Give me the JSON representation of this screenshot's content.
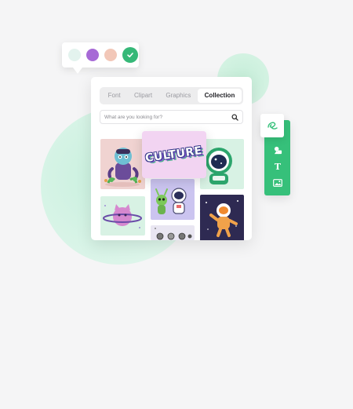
{
  "palette": {
    "swatches": [
      {
        "name": "mint",
        "color": "#e3f3ee"
      },
      {
        "name": "purple",
        "color": "#a76ad6"
      },
      {
        "name": "peach",
        "color": "#f2c7b8"
      },
      {
        "name": "green",
        "color": "#36b878",
        "selected": true
      }
    ]
  },
  "tabs": [
    {
      "label": "Font"
    },
    {
      "label": "Clipart"
    },
    {
      "label": "Graphics"
    },
    {
      "label": "Collection",
      "active": true
    }
  ],
  "search": {
    "placeholder": "What are you looking for?",
    "icon": "search-icon"
  },
  "overlay": {
    "text": "CULTURE"
  },
  "toolbar": {
    "items": [
      "brush-icon",
      "shapes-icon",
      "text-icon",
      "image-icon"
    ],
    "text_glyph": "T"
  },
  "colors": {
    "accent": "#36c07a",
    "card_bg": "#ffffff",
    "page_bg": "#f5f5f6"
  }
}
